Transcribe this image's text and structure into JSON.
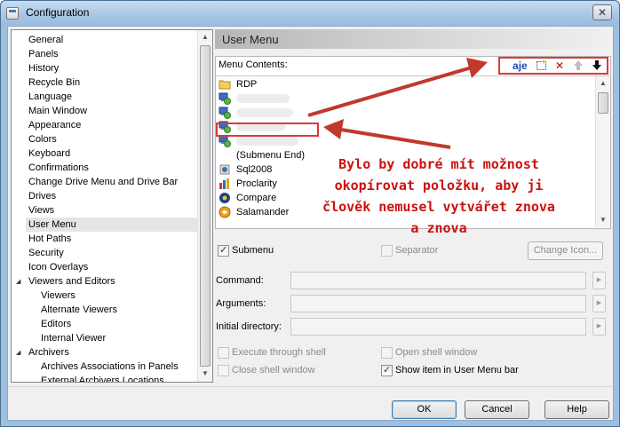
{
  "window": {
    "title": "Configuration",
    "close_glyph": "✕"
  },
  "tree": {
    "items": [
      {
        "label": "General",
        "level": 0
      },
      {
        "label": "Panels",
        "level": 0
      },
      {
        "label": "History",
        "level": 0
      },
      {
        "label": "Recycle Bin",
        "level": 0
      },
      {
        "label": "Language",
        "level": 0
      },
      {
        "label": "Main Window",
        "level": 0
      },
      {
        "label": "Appearance",
        "level": 0
      },
      {
        "label": "Colors",
        "level": 0
      },
      {
        "label": "Keyboard",
        "level": 0
      },
      {
        "label": "Confirmations",
        "level": 0
      },
      {
        "label": "Change Drive Menu and Drive Bar",
        "level": 0
      },
      {
        "label": "Drives",
        "level": 0
      },
      {
        "label": "Views",
        "level": 0
      },
      {
        "label": "User Menu",
        "level": 0,
        "selected": true
      },
      {
        "label": "Hot Paths",
        "level": 0
      },
      {
        "label": "Security",
        "level": 0
      },
      {
        "label": "Icon Overlays",
        "level": 0
      },
      {
        "label": "Viewers and Editors",
        "level": 0,
        "expandable": true
      },
      {
        "label": "Viewers",
        "level": 1
      },
      {
        "label": "Alternate Viewers",
        "level": 1
      },
      {
        "label": "Editors",
        "level": 1
      },
      {
        "label": "Internal Viewer",
        "level": 1
      },
      {
        "label": "Archivers",
        "level": 0,
        "expandable": true
      },
      {
        "label": "Archives Associations in Panels",
        "level": 1
      },
      {
        "label": "External Archivers Locations",
        "level": 1
      }
    ]
  },
  "panel": {
    "title": "User Menu"
  },
  "menu_contents": {
    "label": "Menu Contents:",
    "toolbar": [
      {
        "name": "rename",
        "glyph": "a͟je"
      },
      {
        "name": "new-item",
        "glyph": "⬚"
      },
      {
        "name": "delete",
        "glyph": "✕"
      },
      {
        "name": "move-up",
        "glyph": "🡅"
      },
      {
        "name": "move-down",
        "glyph": "🡇"
      }
    ],
    "items": [
      {
        "label": "RDP",
        "icon": "folder"
      },
      {
        "label": "",
        "icon": "rdp",
        "blurred": true
      },
      {
        "label": "",
        "icon": "rdp",
        "blurred": true
      },
      {
        "label": "",
        "icon": "rdp",
        "blurred": true
      },
      {
        "label": "",
        "icon": "rdp",
        "blurred": true
      },
      {
        "label": "(Submenu End)",
        "icon": "none"
      },
      {
        "label": "Sql2008",
        "icon": "sql"
      },
      {
        "label": "Proclarity",
        "icon": "proclarity"
      },
      {
        "label": "Compare",
        "icon": "compare"
      },
      {
        "label": "Salamander",
        "icon": "salamander"
      }
    ]
  },
  "annotation": {
    "lines": [
      "Bylo by dobré mít možnost",
      "okopírovat položku, aby ji",
      "člověk nemusel vytvářet znova",
      "a znova"
    ],
    "color": "#cc1111"
  },
  "options": {
    "submenu": {
      "label": "Submenu",
      "checked": true
    },
    "separator": {
      "label": "Separator",
      "checked": false
    },
    "change_icon": "Change Icon...",
    "command_label": "Command:",
    "arguments_label": "Arguments:",
    "initial_directory_label": "Initial directory:",
    "execute_through_shell": {
      "label": "Execute through shell",
      "checked": false
    },
    "open_shell_window": {
      "label": "Open shell window",
      "checked": false
    },
    "close_shell_window": {
      "label": "Close shell window",
      "checked": false
    },
    "show_in_user_menu_bar": {
      "label": "Show item in User Menu bar",
      "checked": true
    }
  },
  "buttons": {
    "ok": "OK",
    "cancel": "Cancel",
    "help": "Help"
  },
  "colors": {
    "annotation_red": "#d93a3a",
    "titlebar": "#a9c6e4",
    "selection": "#e5e5e5"
  }
}
